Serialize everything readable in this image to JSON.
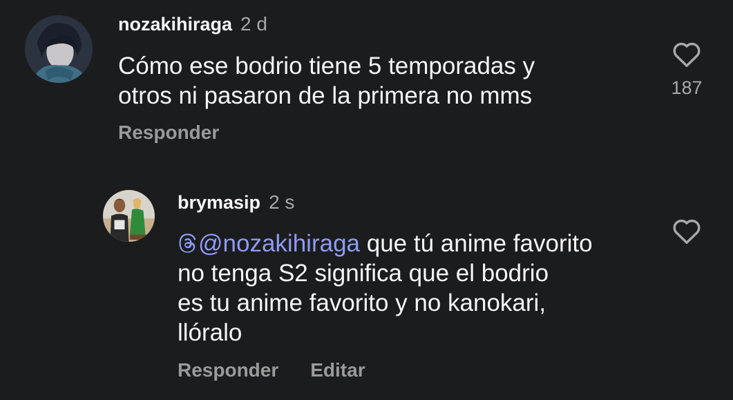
{
  "comments": [
    {
      "username": "nozakihiraga",
      "time": "2 d",
      "lines": [
        "Cómo ese bodrio tiene 5 temporadas y",
        "otros ni pasaron de la primera no mms"
      ],
      "reply_label": "Responder",
      "like_count": "187"
    },
    {
      "username": "brymasip",
      "time": "2 s",
      "mention": "@nozakihiraga",
      "lines": [
        " que tú anime favorito",
        "no tenga S2 significa que el bodrio",
        "es tu anime favorito y no kanokari,",
        "llóralo"
      ],
      "reply_label": "Responder",
      "edit_label": "Editar"
    }
  ],
  "icons": {
    "like": "heart-outline-icon",
    "mention": "threads-at-icon"
  },
  "colors": {
    "background": "#1b1c1e",
    "mention": "#8e9bf5",
    "secondary_text": "#9a9a9a"
  }
}
